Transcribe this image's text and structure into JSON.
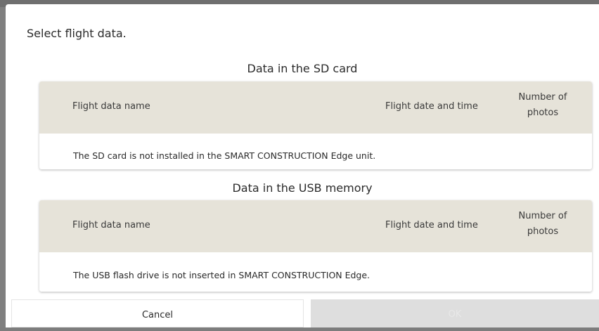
{
  "dialog": {
    "title": "Select flight data."
  },
  "sd_section": {
    "title": "Data in the SD card",
    "columns": {
      "name": "Flight data name",
      "date": "Flight date and time",
      "photos": "Number of\nphotos"
    },
    "message": "The SD card is not installed in the SMART CONSTRUCTION Edge unit."
  },
  "usb_section": {
    "title": "Data in the USB memory",
    "columns": {
      "name": "Flight data name",
      "date": "Flight date and time",
      "photos": "Number of\nphotos"
    },
    "message": "The USB flash drive is not inserted in SMART CONSTRUCTION Edge."
  },
  "buttons": {
    "cancel": "Cancel",
    "ok": "OK"
  },
  "colors": {
    "header_bg": "#e6e3d9",
    "ok_disabled_bg": "#dedede",
    "backdrop": "#7f7f7f"
  }
}
